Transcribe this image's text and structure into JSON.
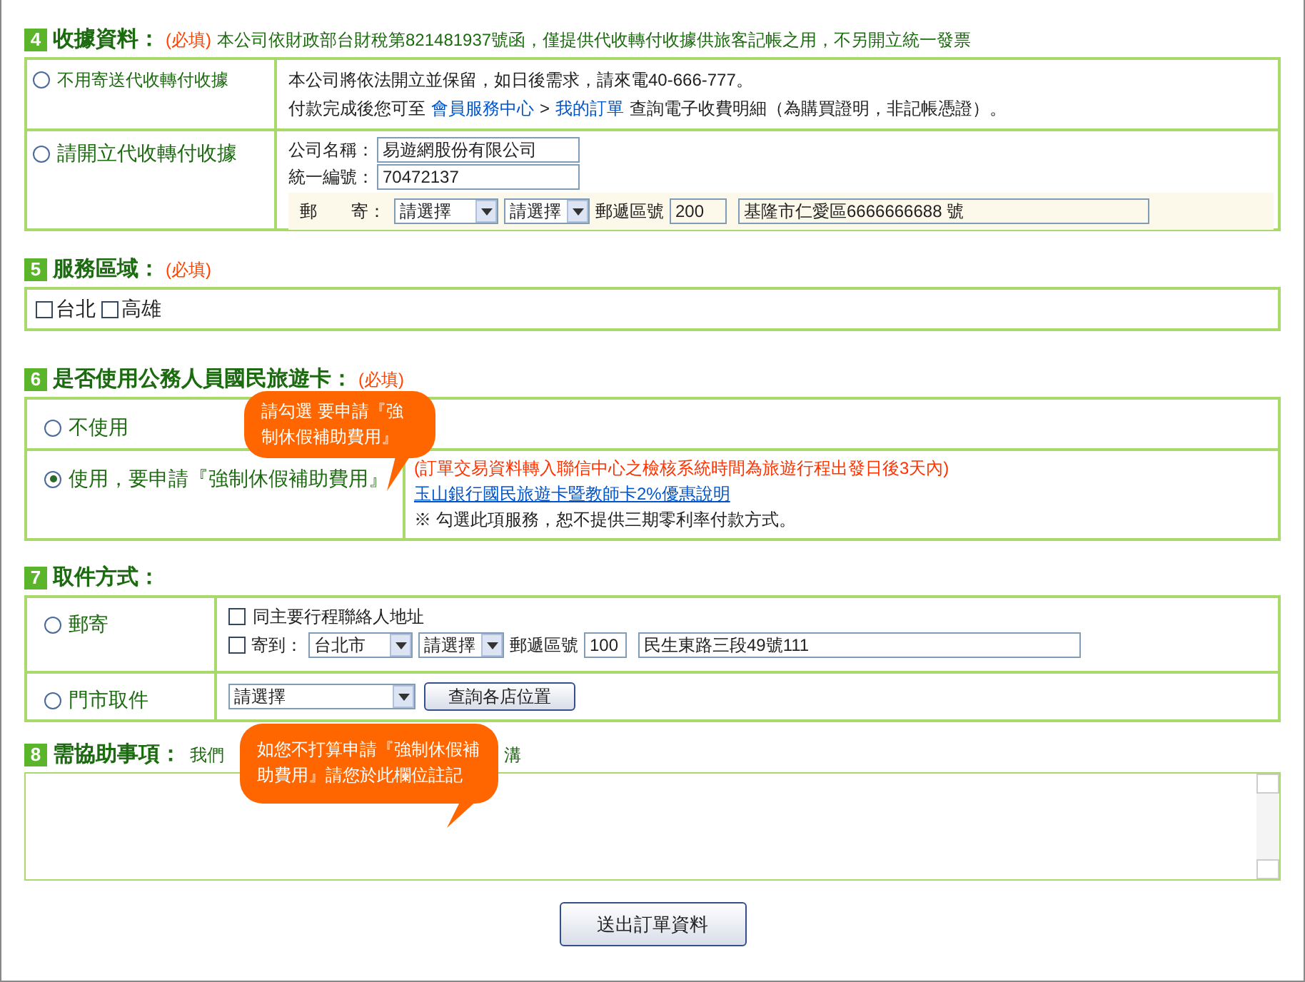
{
  "receipt": {
    "number": "4",
    "title": "收據資料：",
    "required": "(必填)",
    "note": "本公司依財政部台財稅第821481937號函，僅提供代收轉付收據供旅客記帳之用，不另開立統一發票",
    "options": [
      {
        "label": "不用寄送代收轉付收據",
        "selected": false
      },
      {
        "label": "請開立代收轉付收據",
        "selected": false
      }
    ],
    "no_mail": {
      "line1": "本公司將依法開立並保留，如日後需求，請來電40-666-777。",
      "prefix": "付款完成後您可至",
      "link1": "會員服務中心",
      "separator": ">",
      "link2": "我的訂單",
      "suffix": "查詢電子收費明細（為購買證明，非記帳憑證）。"
    },
    "issue": {
      "company_label": "公司名稱：",
      "company": "易遊網股份有限公司",
      "tax_label": "統一編號：",
      "tax_id": "70472137",
      "mail_label": "郵　　寄：",
      "select_1": "請選擇",
      "select_2": "請選擇",
      "zip_label": "郵遞區號",
      "zip": "200",
      "address": "基隆市仁愛區6666666688 號"
    }
  },
  "service_area": {
    "number": "5",
    "title": "服務區域：",
    "required": "(必填)",
    "options": [
      {
        "label": "台北",
        "checked": false
      },
      {
        "label": "高雄",
        "checked": false
      }
    ]
  },
  "travel_card": {
    "number": "6",
    "title": "是否使用公務人員國民旅遊卡：",
    "required": "(必填)",
    "options": [
      {
        "label": "不使用",
        "selected": false
      },
      {
        "label": "使用，要申請『強制休假補助費用』",
        "selected": true
      }
    ],
    "notice": "(訂單交易資料轉入聯信中心之檢核系統時間為旅遊行程出發日後3天內)",
    "link": "玉山銀行國民旅遊卡暨教師卡2%優惠說明",
    "note": "※ 勾選此項服務，恕不提供三期零利率付款方式。"
  },
  "pickup": {
    "number": "7",
    "title": "取件方式：",
    "options": [
      {
        "kind": "mail",
        "label": "郵寄",
        "selected": false
      },
      {
        "kind": "store",
        "label": "門市取件",
        "selected": false
      }
    ],
    "mail": {
      "same_as_contact": {
        "label": "同主要行程聯絡人地址",
        "checked": false
      },
      "send_to": {
        "label": "寄到：",
        "checked": false
      },
      "city": "台北市",
      "district": "請選擇",
      "zip_label": "郵遞區號",
      "zip": "100",
      "address": "民生東路三段49號111"
    },
    "store": {
      "select": "請選擇",
      "button": "查詢各店位置"
    }
  },
  "assistance": {
    "number": "8",
    "title": "需協助事項：",
    "hint_start": "我們",
    "hint_end": "溝"
  },
  "submit_button": "送出訂單資料",
  "callouts": [
    "請勾選 要申請『強制休假補助費用』",
    "如您不打算申請『強制休假補助費用』請您於此欄位註記"
  ]
}
